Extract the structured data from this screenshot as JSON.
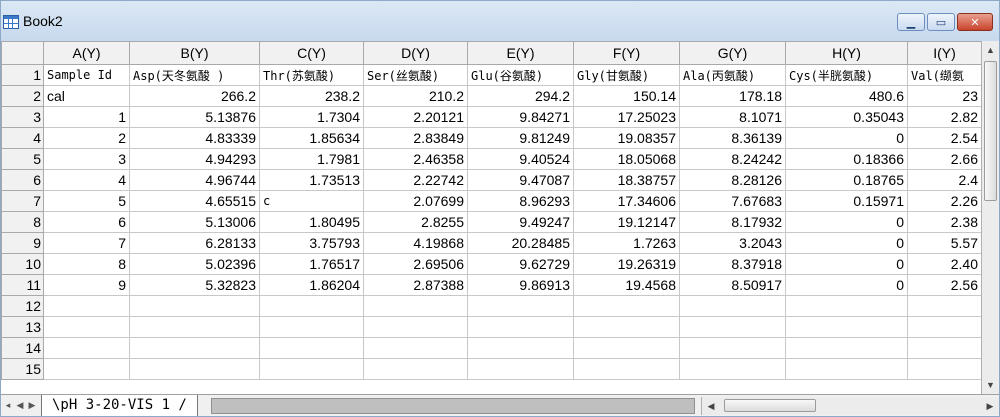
{
  "window": {
    "title": "Book2"
  },
  "window_buttons": {
    "minimize": "▁",
    "restore": "▭",
    "close": "✕"
  },
  "columns": [
    "A(Y)",
    "B(Y)",
    "C(Y)",
    "D(Y)",
    "E(Y)",
    "F(Y)",
    "G(Y)",
    "H(Y)",
    "I(Y)"
  ],
  "rows": [
    {
      "n": "1",
      "cells": [
        "Sample Id",
        "Asp(天冬氨酸 )",
        "Thr(苏氨酸)",
        "Ser(丝氨酸)",
        "Glu(谷氨酸)",
        "Gly(甘氨酸)",
        "Ala(丙氨酸)",
        "Cys(半胱氨酸)",
        "Val(缬氨"
      ]
    },
    {
      "n": "2",
      "cells": [
        "cal",
        "266.2",
        "238.2",
        "210.2",
        "294.2",
        "150.14",
        "178.18",
        "480.6",
        "23"
      ]
    },
    {
      "n": "3",
      "cells": [
        "1",
        "5.13876",
        "1.7304",
        "2.20121",
        "9.84271",
        "17.25023",
        "8.1071",
        "0.35043",
        "2.82"
      ]
    },
    {
      "n": "4",
      "cells": [
        "2",
        "4.83339",
        "1.85634",
        "2.83849",
        "9.81249",
        "19.08357",
        "8.36139",
        "0",
        "2.54"
      ]
    },
    {
      "n": "5",
      "cells": [
        "3",
        "4.94293",
        "1.7981",
        "2.46358",
        "9.40524",
        "18.05068",
        "8.24242",
        "0.18366",
        "2.66"
      ]
    },
    {
      "n": "6",
      "cells": [
        "4",
        "4.96744",
        "1.73513",
        "2.22742",
        "9.47087",
        "18.38757",
        "8.28126",
        "0.18765",
        "2.4"
      ]
    },
    {
      "n": "7",
      "cells": [
        "5",
        "4.65515",
        "c",
        "2.07699",
        "8.96293",
        "17.34606",
        "7.67683",
        "0.15971",
        "2.26"
      ]
    },
    {
      "n": "8",
      "cells": [
        "6",
        "5.13006",
        "1.80495",
        "2.8255",
        "9.49247",
        "19.12147",
        "8.17932",
        "0",
        "2.38"
      ]
    },
    {
      "n": "9",
      "cells": [
        "7",
        "6.28133",
        "3.75793",
        "4.19868",
        "20.28485",
        "1.7263",
        "3.2043",
        "0",
        "5.57"
      ]
    },
    {
      "n": "10",
      "cells": [
        "8",
        "5.02396",
        "1.76517",
        "2.69506",
        "9.62729",
        "19.26319",
        "8.37918",
        "0",
        "2.40"
      ]
    },
    {
      "n": "11",
      "cells": [
        "9",
        "5.32823",
        "1.86204",
        "2.87388",
        "9.86913",
        "19.4568",
        "8.50917",
        "0",
        "2.56"
      ]
    },
    {
      "n": "12",
      "cells": [
        "",
        "",
        "",
        "",
        "",
        "",
        "",
        "",
        ""
      ]
    },
    {
      "n": "13",
      "cells": [
        "",
        "",
        "",
        "",
        "",
        "",
        "",
        "",
        ""
      ]
    },
    {
      "n": "14",
      "cells": [
        "",
        "",
        "",
        "",
        "",
        "",
        "",
        "",
        ""
      ]
    },
    {
      "n": "15",
      "cells": [
        "",
        "",
        "",
        "",
        "",
        "",
        "",
        "",
        ""
      ]
    }
  ],
  "sheet_tab": {
    "label": "\\pH 3-20-VIS 1 /"
  },
  "scroll_arrows": {
    "left": "◀",
    "right": "▶",
    "first": "◂",
    "last": "▸",
    "up": "▲",
    "down": "▼"
  },
  "colors": {
    "frame": "#8ea9c8",
    "header_bg": "#f1f1f1",
    "grid": "#c8c8c8",
    "close_btn": "#c9442c"
  }
}
